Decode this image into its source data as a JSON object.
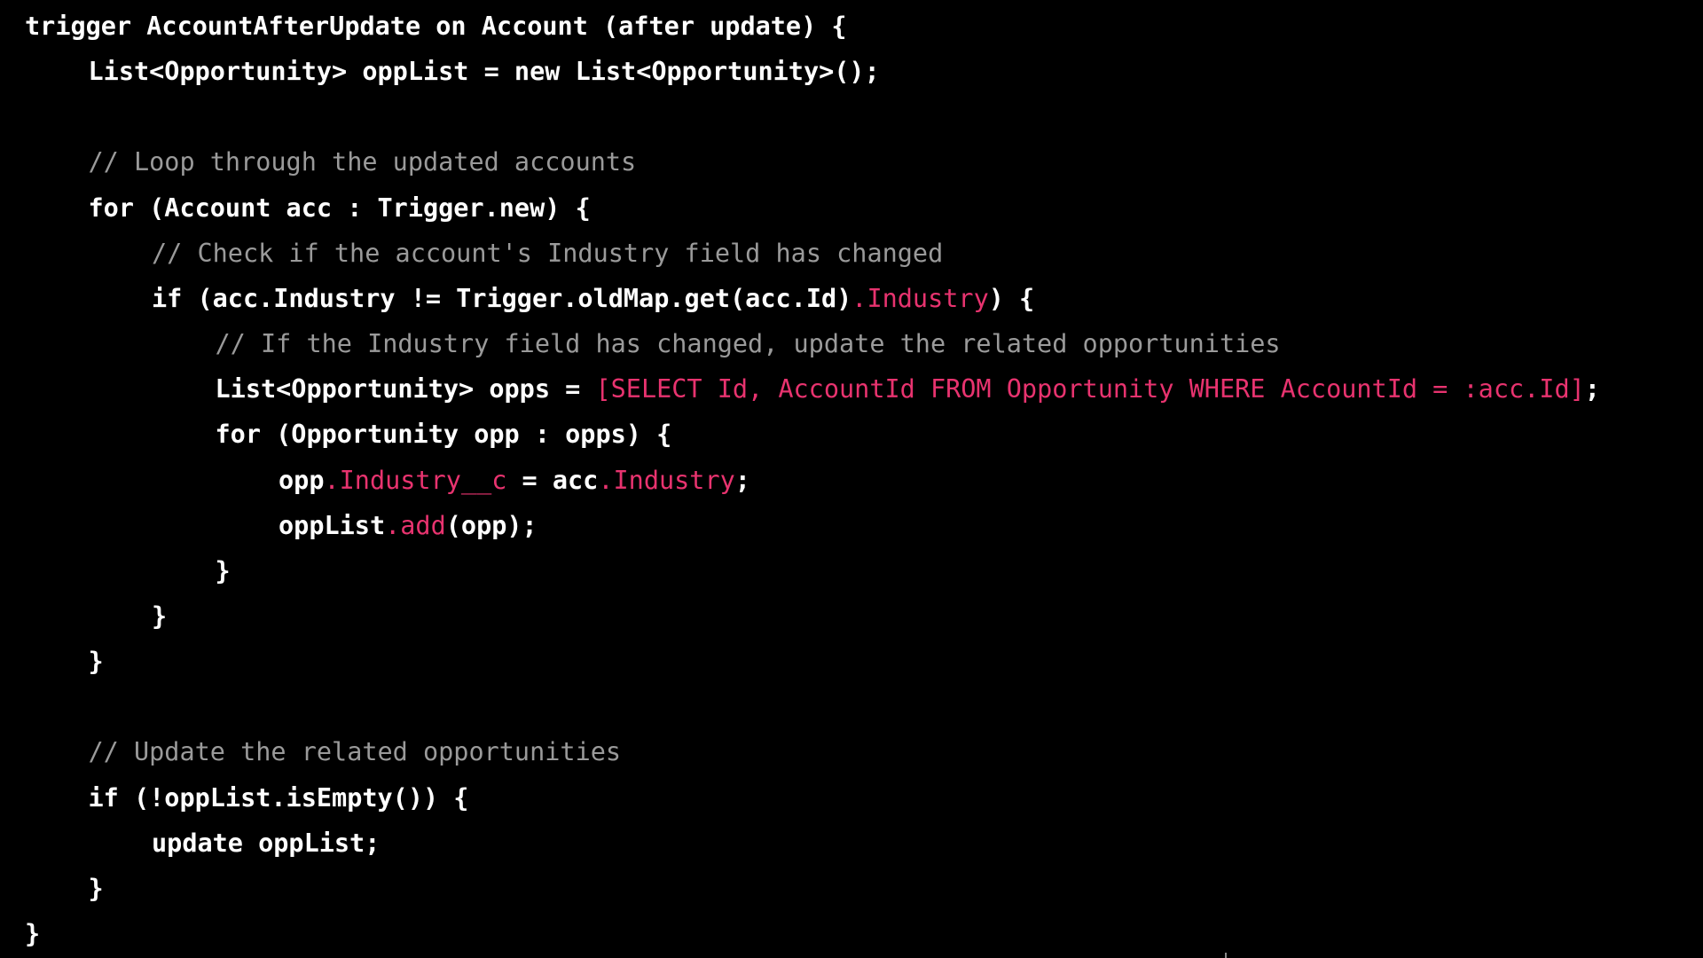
{
  "editor": {
    "background": "#000000",
    "colors": {
      "code": "#ffffff",
      "comment": "#9a9a9a",
      "highlight": "#e8336f"
    },
    "lines": [
      {
        "indent": 0,
        "tokens": [
          {
            "t": "code",
            "s": "trigger AccountAfterUpdate on Account (after update) {"
          }
        ]
      },
      {
        "indent": 1,
        "tokens": [
          {
            "t": "code",
            "s": "List<Opportunity> oppList = new List<Opportunity>();"
          }
        ]
      },
      {
        "indent": 0,
        "tokens": []
      },
      {
        "indent": 1,
        "tokens": [
          {
            "t": "comment",
            "s": "// Loop through the updated accounts"
          }
        ]
      },
      {
        "indent": 1,
        "tokens": [
          {
            "t": "code",
            "s": "for (Account acc : Trigger.new) {"
          }
        ]
      },
      {
        "indent": 2,
        "tokens": [
          {
            "t": "comment",
            "s": "// Check if the account's Industry field has changed"
          }
        ]
      },
      {
        "indent": 2,
        "tokens": [
          {
            "t": "code",
            "s": "if (acc.Industry != Trigger.oldMap.get(acc.Id)"
          },
          {
            "t": "pink",
            "s": ".Industry"
          },
          {
            "t": "code",
            "s": ") {"
          }
        ]
      },
      {
        "indent": 3,
        "tokens": [
          {
            "t": "comment",
            "s": "// If the Industry field has changed, update the related opportunities"
          }
        ]
      },
      {
        "indent": 3,
        "tokens": [
          {
            "t": "code",
            "s": "List<Opportunity> opps = "
          },
          {
            "t": "pink",
            "s": "[SELECT Id, AccountId FROM Opportunity WHERE AccountId = :acc.Id]"
          },
          {
            "t": "code",
            "s": ";"
          }
        ]
      },
      {
        "indent": 3,
        "tokens": [
          {
            "t": "code",
            "s": "for (Opportunity opp : opps) {"
          }
        ]
      },
      {
        "indent": 4,
        "tokens": [
          {
            "t": "code",
            "s": "opp"
          },
          {
            "t": "pink",
            "s": ".Industry__c"
          },
          {
            "t": "code",
            "s": " = acc"
          },
          {
            "t": "pink",
            "s": ".Industry"
          },
          {
            "t": "code",
            "s": ";"
          }
        ]
      },
      {
        "indent": 4,
        "tokens": [
          {
            "t": "code",
            "s": "oppList"
          },
          {
            "t": "pink",
            "s": ".add"
          },
          {
            "t": "code",
            "s": "(opp);"
          }
        ]
      },
      {
        "indent": 3,
        "tokens": [
          {
            "t": "code",
            "s": "}"
          }
        ]
      },
      {
        "indent": 2,
        "tokens": [
          {
            "t": "code",
            "s": "}"
          }
        ]
      },
      {
        "indent": 1,
        "tokens": [
          {
            "t": "code",
            "s": "}"
          }
        ]
      },
      {
        "indent": 0,
        "tokens": []
      },
      {
        "indent": 1,
        "tokens": [
          {
            "t": "comment",
            "s": "// Update the related opportunities"
          }
        ]
      },
      {
        "indent": 1,
        "tokens": [
          {
            "t": "code",
            "s": "if (!oppList.isEmpty()) {"
          }
        ]
      },
      {
        "indent": 2,
        "tokens": [
          {
            "t": "code",
            "s": "update oppList;"
          }
        ]
      },
      {
        "indent": 1,
        "tokens": [
          {
            "t": "code",
            "s": "}"
          }
        ]
      },
      {
        "indent": 0,
        "tokens": [
          {
            "t": "code",
            "s": "}"
          }
        ]
      }
    ]
  }
}
